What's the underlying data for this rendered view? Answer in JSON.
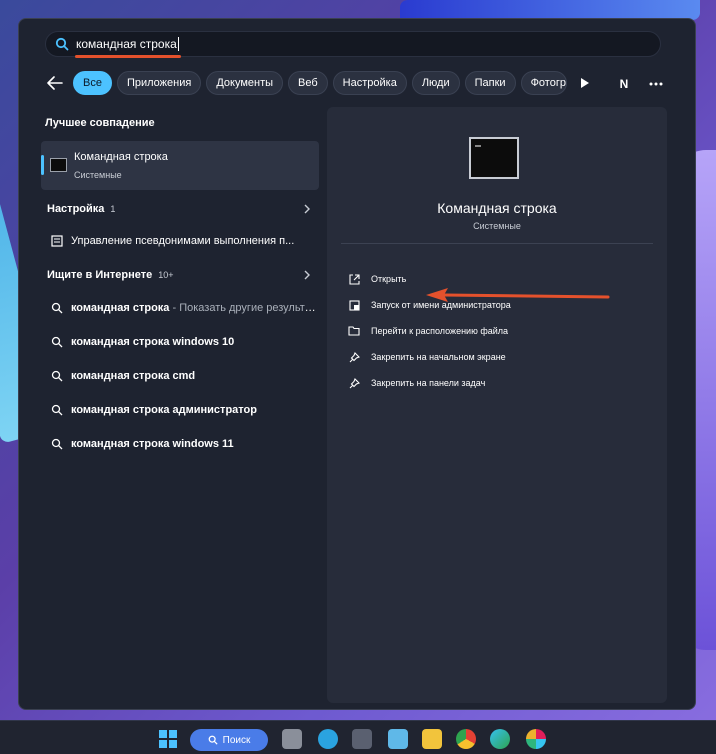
{
  "search": {
    "query": "командная строка"
  },
  "filters": [
    "Все",
    "Приложения",
    "Документы",
    "Веб",
    "Настройка",
    "Люди",
    "Папки",
    "Фотогр"
  ],
  "avatar_letter": "N",
  "left": {
    "best_match_title": "Лучшее совпадение",
    "best_match": {
      "title": "Командная строка",
      "subtitle": "Системные"
    },
    "settings_section": {
      "title": "Настройка",
      "count": "1"
    },
    "settings_item": "Управление псевдонимами выполнения п...",
    "web_section": {
      "title": "Ищите в Интернете",
      "count": "10+"
    },
    "web_results": [
      {
        "bold": "командная строка",
        "rest": " - Показать другие результа..."
      },
      {
        "bold": "командная строка windows 10",
        "rest": ""
      },
      {
        "bold": "командная строка cmd",
        "rest": ""
      },
      {
        "bold": "командная строка администратор",
        "rest": ""
      },
      {
        "bold": "командная строка windows 11",
        "rest": ""
      }
    ]
  },
  "right": {
    "title": "Командная строка",
    "subtitle": "Системные",
    "actions": [
      "Открыть",
      "Запуск от имени администратора",
      "Перейти к расположению файла",
      "Закрепить на начальном экране",
      "Закрепить на панели задач"
    ]
  },
  "taskbar": {
    "search_label": "Поиск"
  },
  "colors": {
    "accent": "#4cc2ff",
    "underline": "#e4512c",
    "arrow": "#e4512c"
  }
}
